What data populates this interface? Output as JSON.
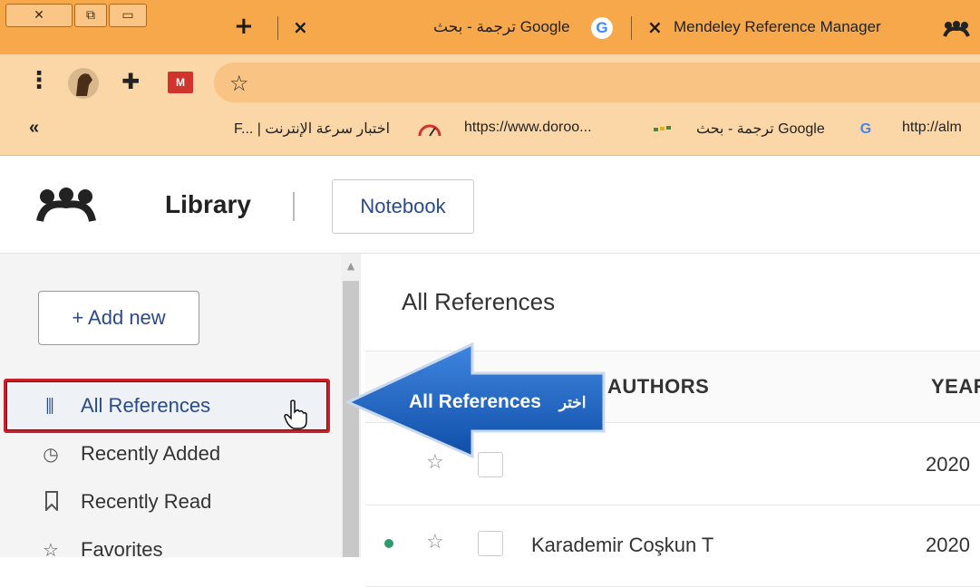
{
  "browser": {
    "window_buttons": [
      "close",
      "restore",
      "minimize"
    ],
    "tabs": [
      {
        "title": "ترجمة - بحث Google",
        "icon": "google-icon"
      },
      {
        "title": "Mendeley Reference Manager",
        "icon": "mendeley-icon"
      }
    ],
    "new_tab_label": "+",
    "close_label": "×",
    "bookmarks_overflow": "«",
    "bookmarks": [
      {
        "label": "F... | اختبار سرعة الإنترنت",
        "icon": "speedtest-icon"
      },
      {
        "label": "https://www.doroo...",
        "icon": "doroob-icon"
      },
      {
        "label": "ترجمة - بحث Google",
        "icon": "google-icon"
      },
      {
        "label": "http://alm",
        "icon": "globe-icon"
      }
    ]
  },
  "app": {
    "header": {
      "title": "Library",
      "notebook_label": "Notebook"
    },
    "sidebar": {
      "add_new_label": "+ Add new",
      "items": [
        {
          "label": "All References",
          "icon": "library-icon",
          "selected": true
        },
        {
          "label": "Recently Added",
          "icon": "clock-icon"
        },
        {
          "label": "Recently Read",
          "icon": "bookmark-icon"
        },
        {
          "label": "Favorites",
          "icon": "star-icon"
        }
      ]
    },
    "main": {
      "title": "All References",
      "columns": {
        "authors": "AUTHORS",
        "year": "YEAR"
      },
      "rows": [
        {
          "author": "",
          "year": "2020",
          "unread": false
        },
        {
          "author": "Karademir Coşkun T",
          "year": "2020",
          "unread": true
        }
      ]
    }
  },
  "annotation": {
    "text_en": "All References",
    "text_ar": "اختر",
    "color": "#1f5fbf"
  }
}
